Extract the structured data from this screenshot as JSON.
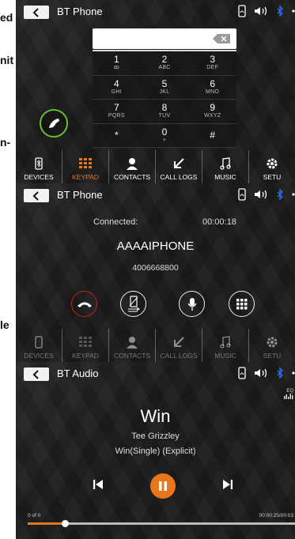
{
  "edge_text": {
    "line1": "ed",
    "line2": "nit",
    "line3": "n-",
    "line4": "le"
  },
  "statusbar": {
    "icons": [
      "phone-battery-icon",
      "volume-icon",
      "bluetooth-icon"
    ]
  },
  "screens": {
    "keypad": {
      "title": "BT Phone",
      "keys": [
        {
          "digit": "1",
          "letters": "ꝏ"
        },
        {
          "digit": "2",
          "letters": "ABC"
        },
        {
          "digit": "3",
          "letters": "DEF"
        },
        {
          "digit": "4",
          "letters": "GHI"
        },
        {
          "digit": "5",
          "letters": "JKL"
        },
        {
          "digit": "6",
          "letters": "MNO"
        },
        {
          "digit": "7",
          "letters": "PQRS"
        },
        {
          "digit": "8",
          "letters": "TUV"
        },
        {
          "digit": "9",
          "letters": "WXYZ"
        },
        {
          "digit": "*",
          "letters": ""
        },
        {
          "digit": "0",
          "letters": "+"
        },
        {
          "digit": "#",
          "letters": ""
        }
      ],
      "active_tab": "KEYPAD"
    },
    "connected": {
      "title": "BT Phone",
      "status": "Connected:",
      "duration": "00:00:18",
      "caller_name": "AAAAIPHONE",
      "caller_number": "4006668800"
    },
    "audio": {
      "title": "BT Audio",
      "eq_label": "EQ",
      "song": "Win",
      "artist": "Tee Grizzley",
      "album": "Win(Single) (Explicit)",
      "track_count": "0 of 0",
      "time": "00:00:25/00:03",
      "progress_fraction": 0.14
    }
  },
  "nav": {
    "items": [
      {
        "label": "DEVICES",
        "icon": "phone-device-icon"
      },
      {
        "label": "KEYPAD",
        "icon": "keypad-icon"
      },
      {
        "label": "CONTACTS",
        "icon": "contacts-icon"
      },
      {
        "label": "CALL LOGS",
        "icon": "call-logs-icon"
      },
      {
        "label": "MUSIC",
        "icon": "music-icon"
      },
      {
        "label": "SETU",
        "icon": "settings-icon"
      }
    ]
  },
  "colors": {
    "accent": "#e8761a",
    "call_green": "#63c036",
    "end_red": "#c0261d",
    "bluetooth": "#2a6df0"
  }
}
